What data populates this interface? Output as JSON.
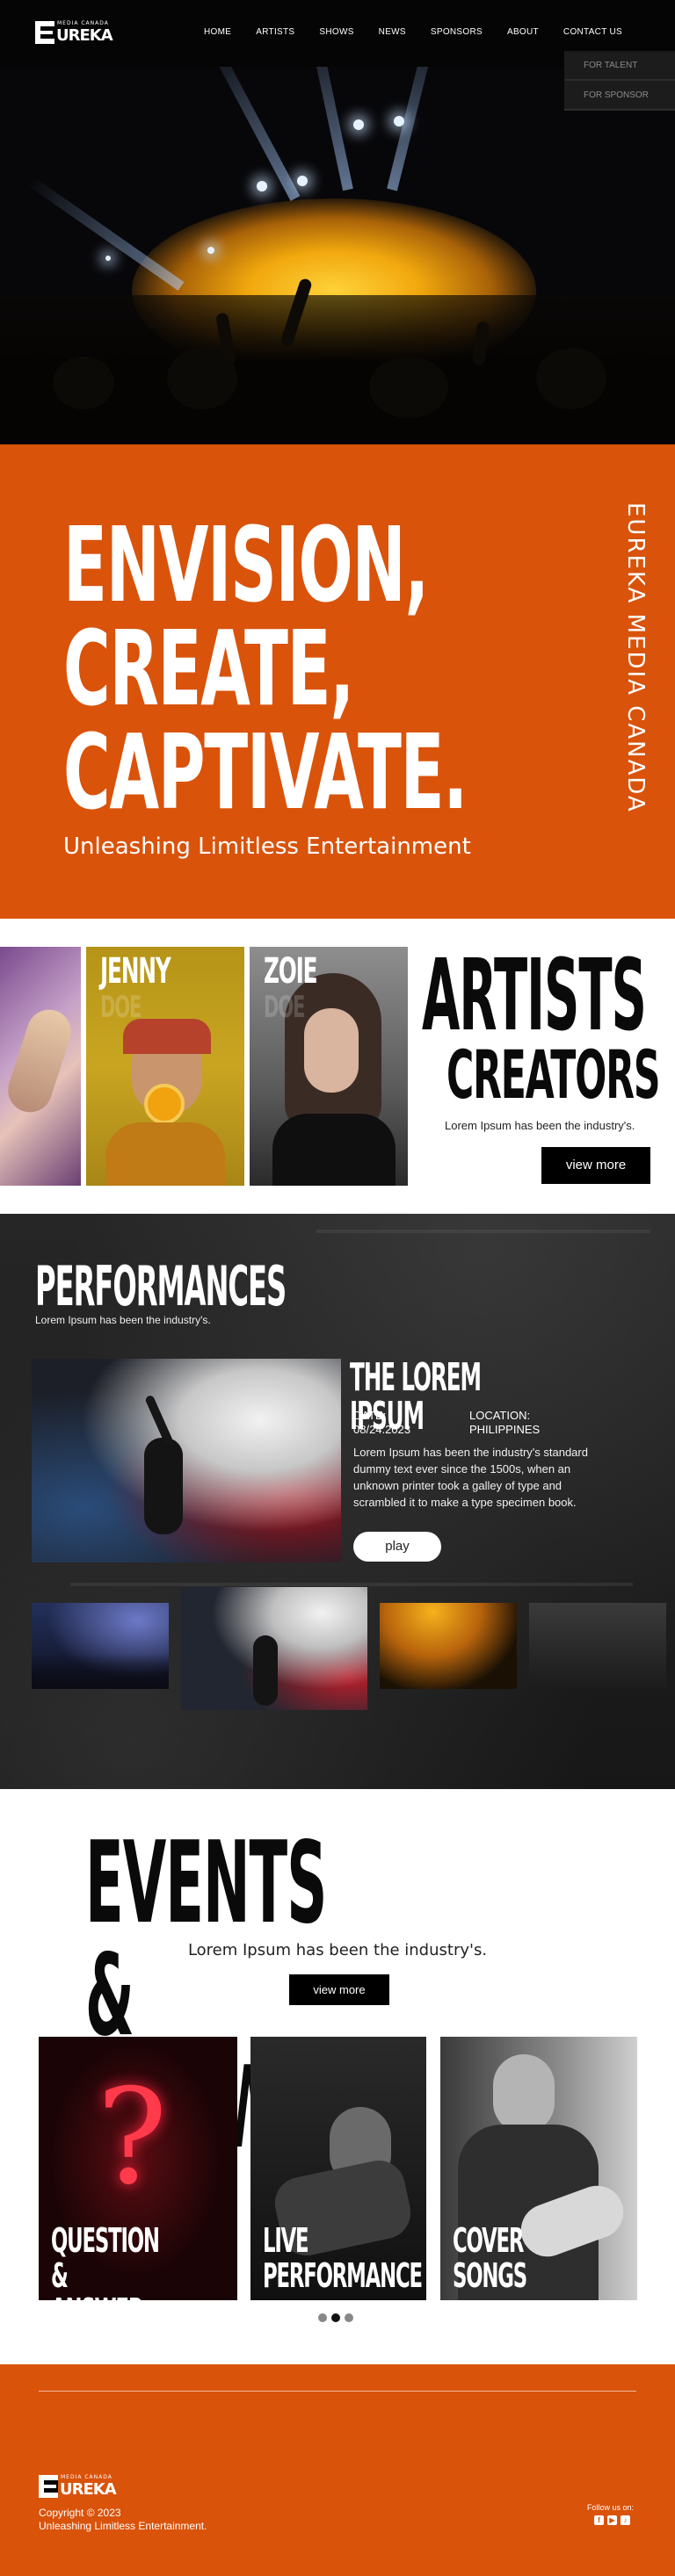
{
  "nav": {
    "logo_small": "MEDIA CANADA",
    "logo_word": "UREKA",
    "items": [
      "HOME",
      "ARTISTS",
      "SHOWS",
      "NEWS",
      "SPONSORS",
      "ABOUT",
      "CONTACT US"
    ],
    "dropdown": [
      "FOR TALENT",
      "FOR SPONSOR"
    ]
  },
  "banner": {
    "lines": [
      "ENVISION,",
      "CREATE,",
      "CAPTIVATE."
    ],
    "subtitle": "Unleashing Limitless Entertainment",
    "vertical": "EUREKA MEDIA CANADA"
  },
  "artists": {
    "cards": [
      {
        "name": "JENNY",
        "surname": "DOE"
      },
      {
        "name": "ZOIE",
        "surname": "DOE"
      }
    ],
    "heading": "ARTISTS",
    "subheading": "CREATORS",
    "lead": "Lorem Ipsum has been the industry's.",
    "button": "view more"
  },
  "performances": {
    "title": "PERFORMANCES",
    "lead": "Lorem Ipsum has been the industry's.",
    "feature": {
      "title": "THE LOREM IPSUM",
      "date_label": "DATE:",
      "date": "08/24.2023",
      "location_label": "LOCATION:",
      "location": "PHILIPPINES",
      "body": "Lorem Ipsum has been the industry's standard dummy text ever since the 1500s, when an unknown printer took a galley of type and scrambled it to make a type specimen book.",
      "button": "play"
    }
  },
  "events": {
    "title": "EVENTS & SHOWS",
    "subtitle": "Lorem Ipsum has been the industry's.",
    "button": "view more",
    "cards": [
      {
        "line1": "QUESTION",
        "line2": "& ANSWER"
      },
      {
        "line1": "LIVE",
        "line2": "PERFORMANCE"
      },
      {
        "line1": "COVER",
        "line2": "SONGS"
      }
    ],
    "active_dot": 1
  },
  "footer": {
    "logo_small": "MEDIA CANADA",
    "logo_word": "UREKA",
    "copyright": "Copyright © 2023",
    "tagline": "Unleashing Limitless Entertainment.",
    "follow": "Follow us on:",
    "social_icons": [
      "facebook-icon",
      "youtube-icon",
      "tiktok-icon"
    ]
  },
  "colors": {
    "accent": "#d9530b",
    "nav": "#050505",
    "dark_section": "#1b1b1b"
  }
}
